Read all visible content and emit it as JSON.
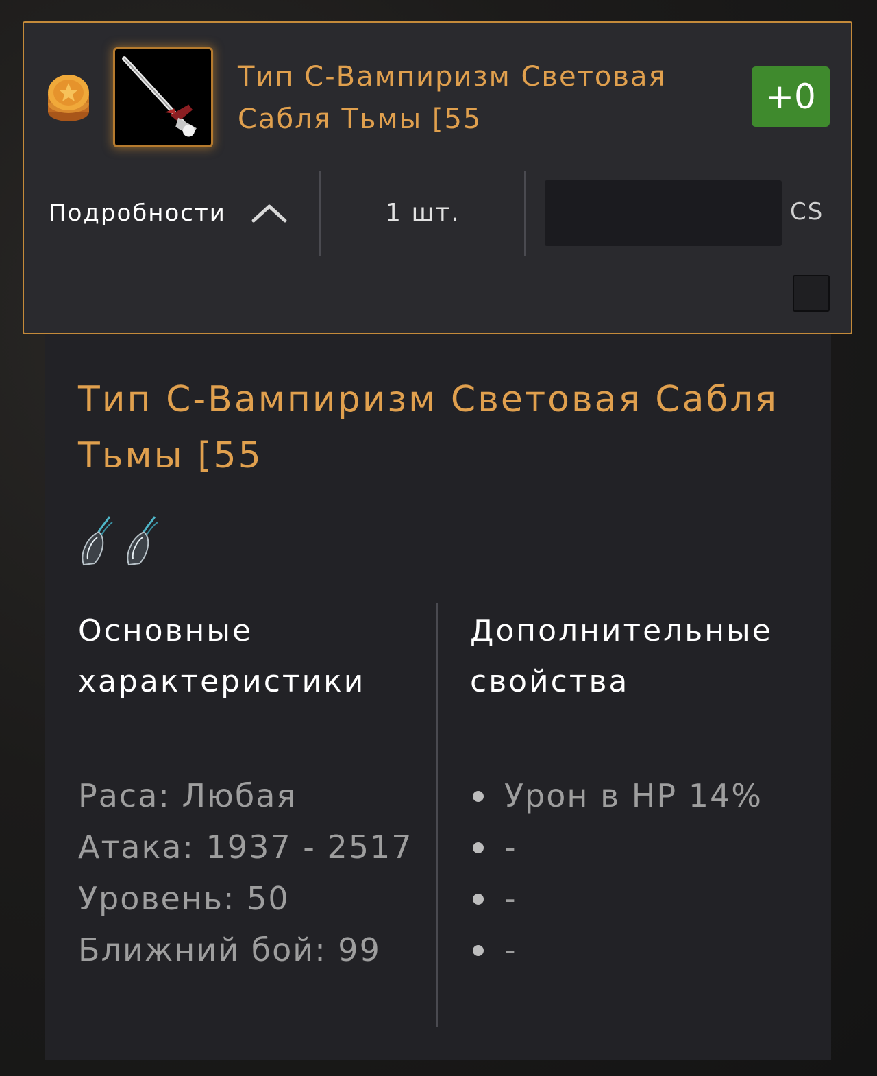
{
  "listing": {
    "item_name": "Тип С-Вампиризм Световая Сабля Тьмы [55",
    "enchant": "+0",
    "details_label": "Подробности",
    "quantity": "1 шт.",
    "price_value": "",
    "currency": "CS",
    "icons": {
      "coin": "gold-coin-stack-icon",
      "item": "sword-item-icon",
      "toggle": "chevron-up-icon"
    }
  },
  "details": {
    "title": "Тип С-Вампиризм Световая Сабля Тьмы [55",
    "gems": [
      "gem-icon",
      "gem-icon"
    ],
    "main_stats": {
      "heading": "Основные характеристики",
      "race": "Раса: Любая",
      "attack": "Атака: 1937 - 2517",
      "level": "Уровень: 50",
      "melee": "Ближний бой: 99"
    },
    "extra_props": {
      "heading": "Дополнительные свойства",
      "items": [
        "Урон в HP 14%",
        "-",
        "-",
        "-"
      ]
    }
  },
  "colors": {
    "accent": "#e0a04e",
    "card_border": "#c48a3a",
    "badge_green": "#3f8a2d",
    "card_bg": "#2a2a2e",
    "panel_bg": "#222226",
    "stat_text": "#9e9e9e"
  }
}
